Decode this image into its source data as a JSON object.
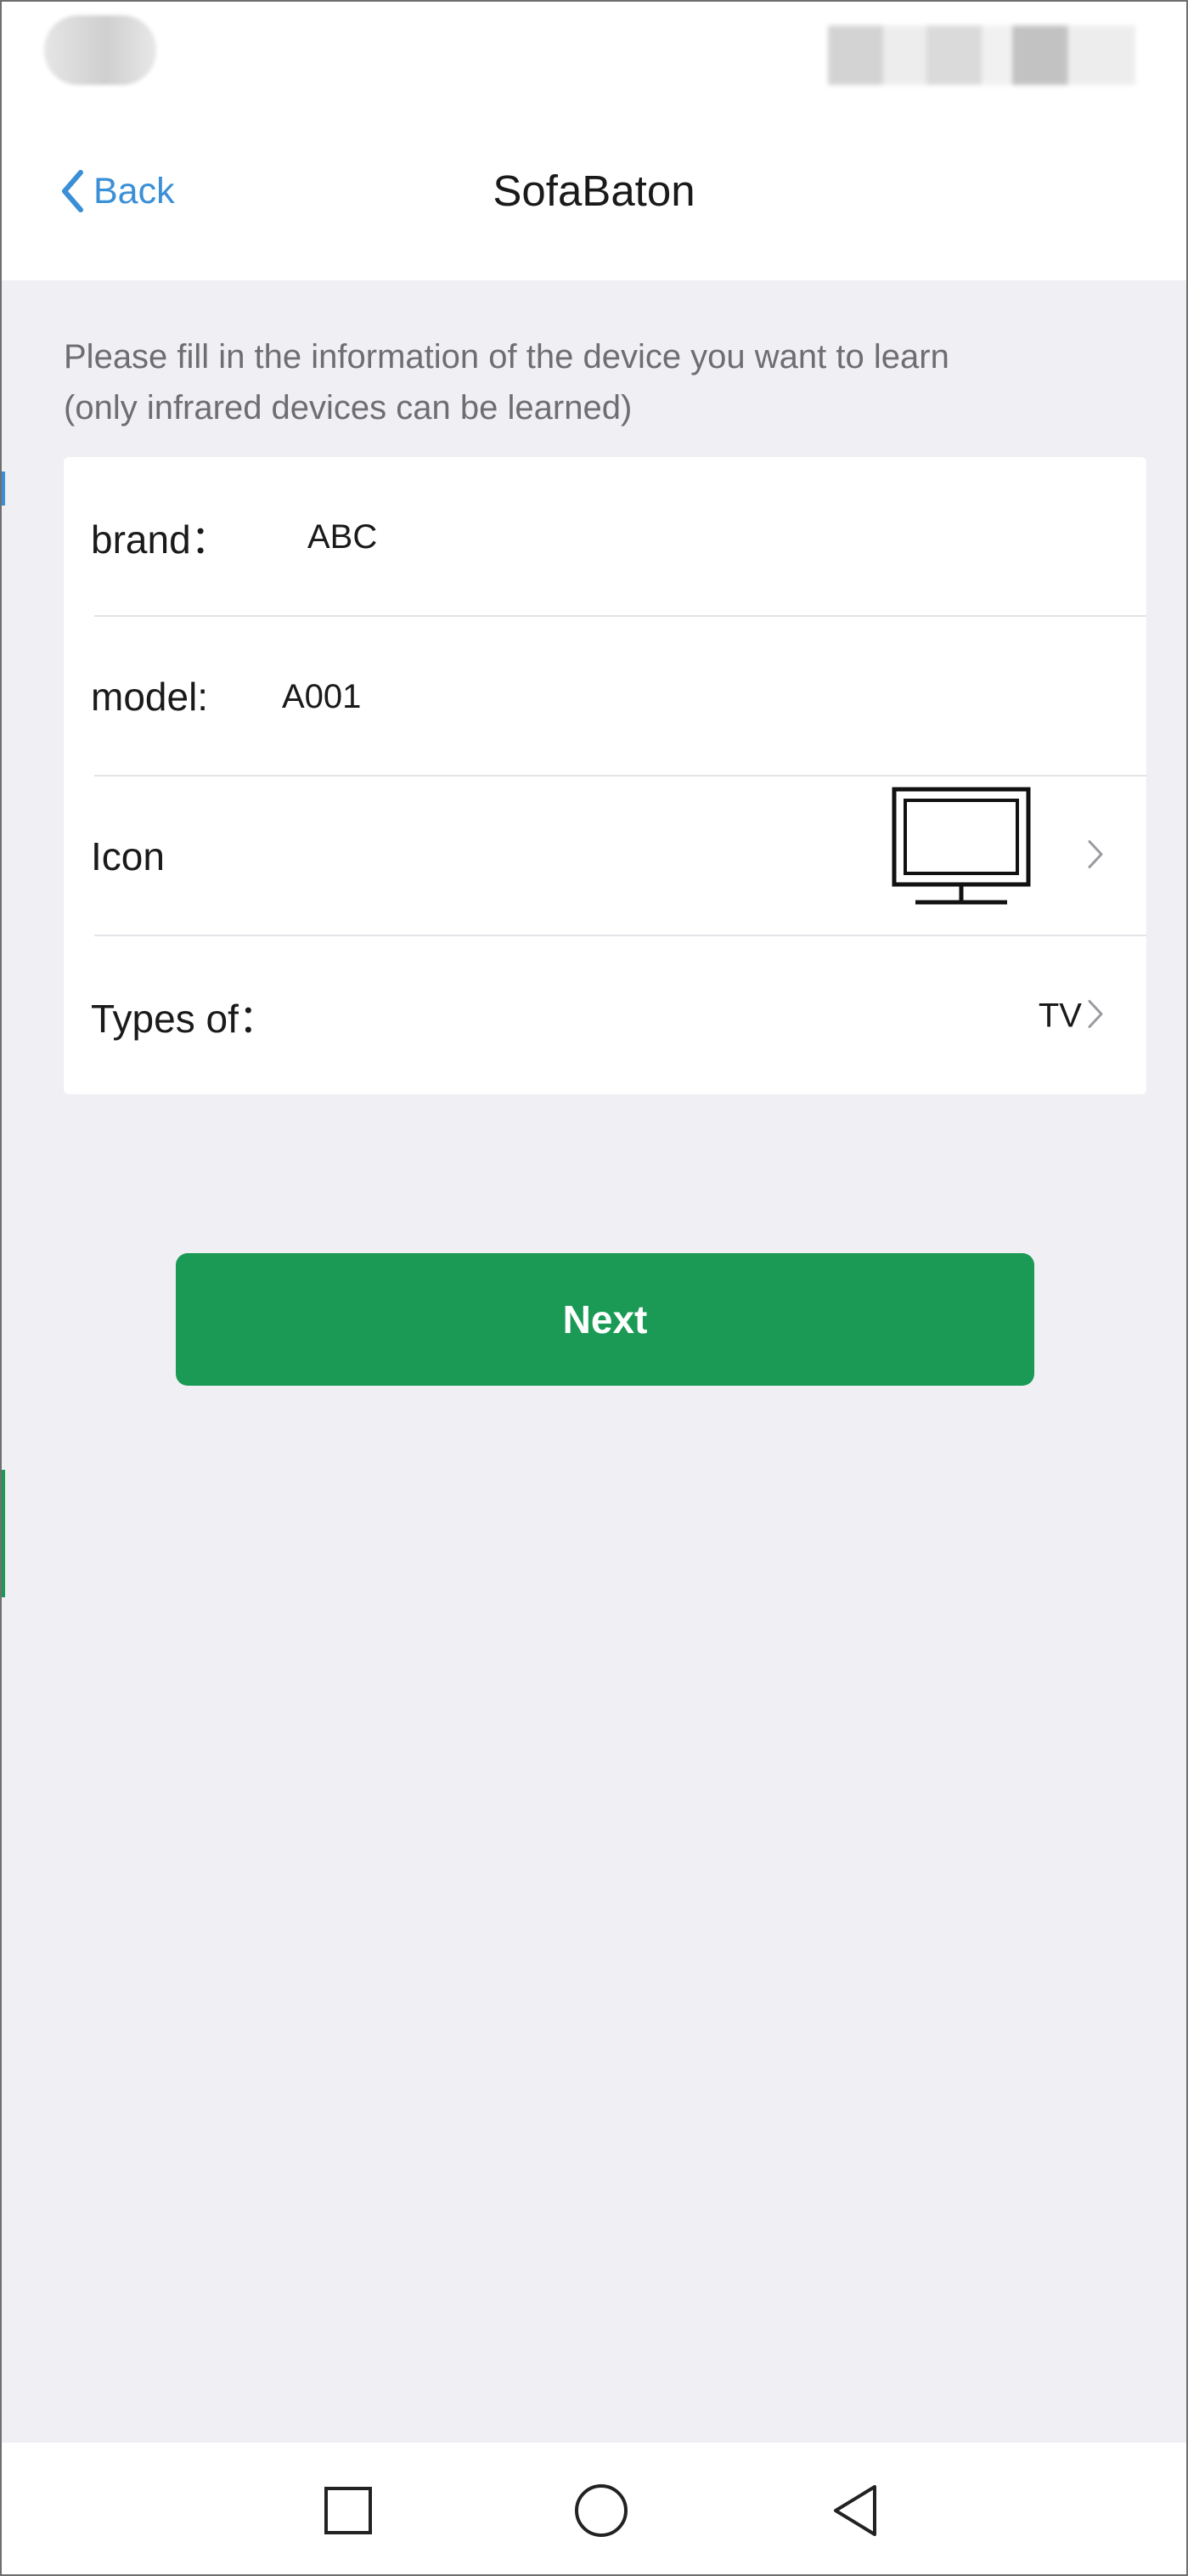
{
  "header": {
    "back_label": "Back",
    "title": "SofaBaton"
  },
  "instruction": {
    "line1": "Please fill in the information of the device you want to learn",
    "line2": "(only infrared devices can be learned)"
  },
  "form": {
    "brand": {
      "label": "brand：",
      "value": "ABC"
    },
    "model": {
      "label": "model:",
      "value": "A001"
    },
    "icon": {
      "label": "Icon",
      "icon_name": "tv-icon"
    },
    "type": {
      "label": "Types of：",
      "value": "TV"
    }
  },
  "next_button": {
    "label": "Next"
  },
  "nav": {
    "items": [
      "recents-square-icon",
      "home-circle-icon",
      "back-triangle-icon"
    ]
  },
  "colors": {
    "accent_blue": "#3a8fd6",
    "primary_green": "#1a9a55",
    "background_gray": "#efeff4"
  }
}
